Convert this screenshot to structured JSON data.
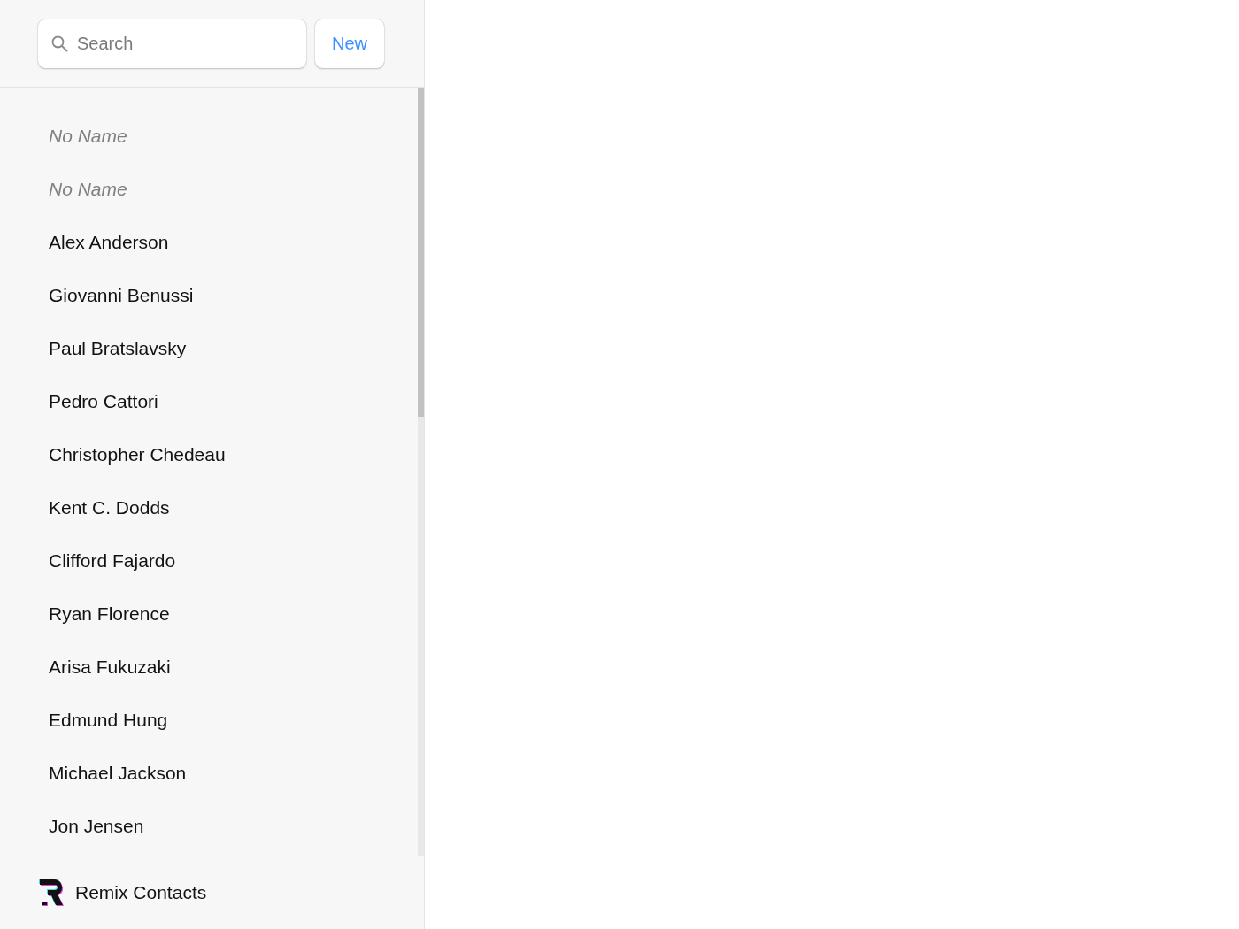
{
  "search": {
    "placeholder": "Search"
  },
  "new_button": {
    "label": "New"
  },
  "contacts": [
    {
      "name": "No Name",
      "kind": "empty"
    },
    {
      "name": "No Name",
      "kind": "empty"
    },
    {
      "name": "Alex Anderson",
      "kind": "named"
    },
    {
      "name": "Giovanni Benussi",
      "kind": "named"
    },
    {
      "name": "Paul Bratslavsky",
      "kind": "named"
    },
    {
      "name": "Pedro Cattori",
      "kind": "named"
    },
    {
      "name": "Christopher Chedeau",
      "kind": "named"
    },
    {
      "name": "Kent C. Dodds",
      "kind": "named"
    },
    {
      "name": "Clifford Fajardo",
      "kind": "named"
    },
    {
      "name": "Ryan Florence",
      "kind": "named"
    },
    {
      "name": "Arisa Fukuzaki",
      "kind": "named"
    },
    {
      "name": "Edmund Hung",
      "kind": "named"
    },
    {
      "name": "Michael Jackson",
      "kind": "named"
    },
    {
      "name": "Jon Jensen",
      "kind": "named"
    }
  ],
  "footer": {
    "title": "Remix Contacts"
  }
}
